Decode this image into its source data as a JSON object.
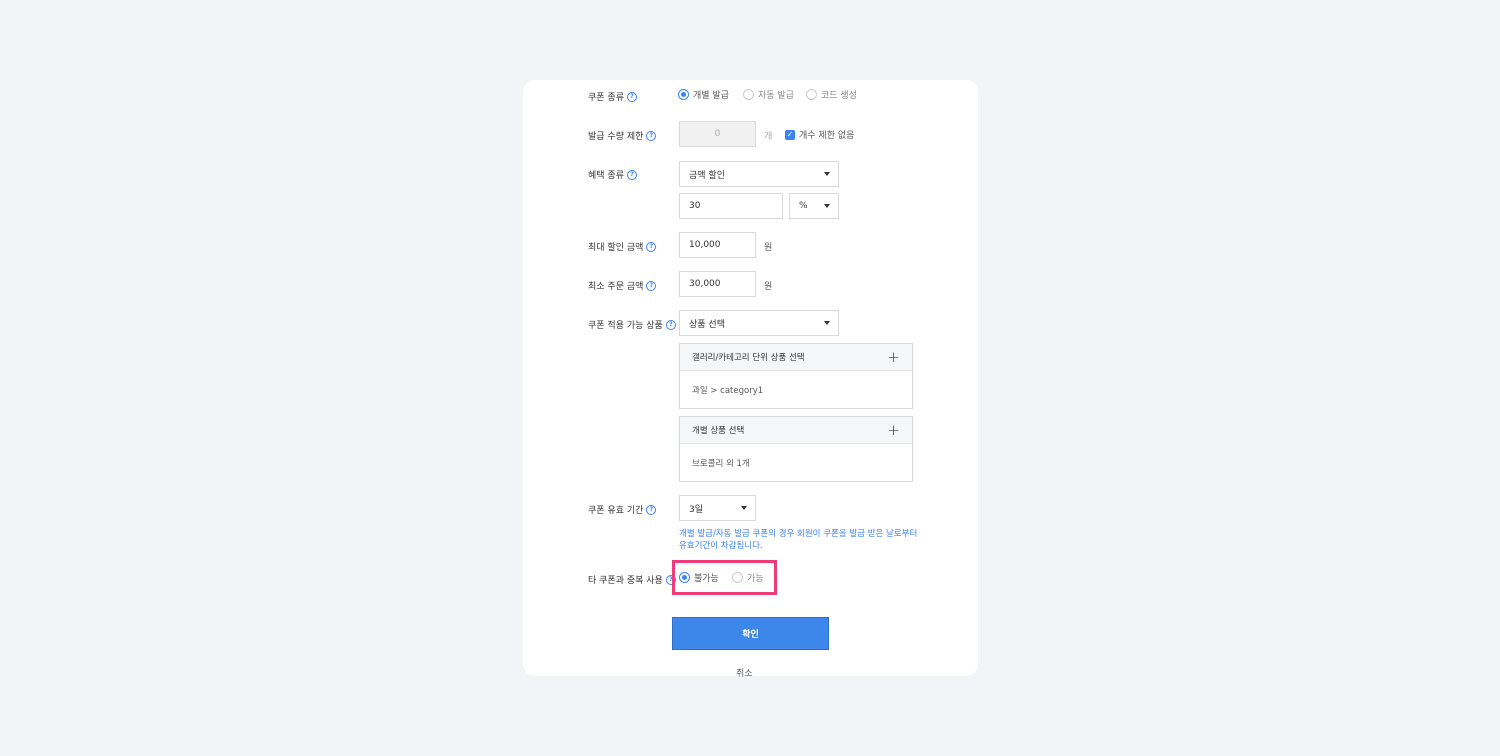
{
  "form": {
    "coupon_type": {
      "label": "쿠폰 종류",
      "options": [
        "개별 발급",
        "자동 발급",
        "코드 생성"
      ],
      "selected": 0
    },
    "issue_limit": {
      "label": "발급 수량 제한",
      "value": "0",
      "unit": "개",
      "checkbox_label": "개수 제한 없음",
      "checked": true
    },
    "benefit_type": {
      "label": "혜택 종류",
      "selected": "금액 할인",
      "amount": "30",
      "unit_select": "%"
    },
    "max_discount": {
      "label": "최대 할인 금액",
      "value": "10,000",
      "unit": "원"
    },
    "min_order": {
      "label": "최소 주문 금액",
      "value": "30,000",
      "unit": "원"
    },
    "applicable_products": {
      "label": "쿠폰 적용 가능 상품",
      "selected": "상품 선택",
      "category_box": {
        "title": "갤러리/카테고리 단위 상품 선택",
        "value": "과일 > category1"
      },
      "product_box": {
        "title": "개별 상품 선택",
        "value": "브로콜리 외 1개"
      }
    },
    "validity": {
      "label": "쿠폰 유효 기간",
      "selected": "3일",
      "hint_line1": "개별 발급/자동 발급 쿠폰의 경우 회원이 쿠폰을 발급 받은 날로부터",
      "hint_line2": "유효기간이 차감됩니다."
    },
    "duplicate_use": {
      "label": "타 쿠폰과 중복 사용",
      "options": [
        "불가능",
        "가능"
      ],
      "selected": 0
    }
  },
  "buttons": {
    "confirm": "확인",
    "cancel": "취소"
  },
  "icons": {
    "help": "?",
    "plus": "+",
    "check": "✓"
  },
  "colors": {
    "accent": "#3d86ea",
    "highlight": "#ef3b7a",
    "background": "#f3f4f7"
  }
}
